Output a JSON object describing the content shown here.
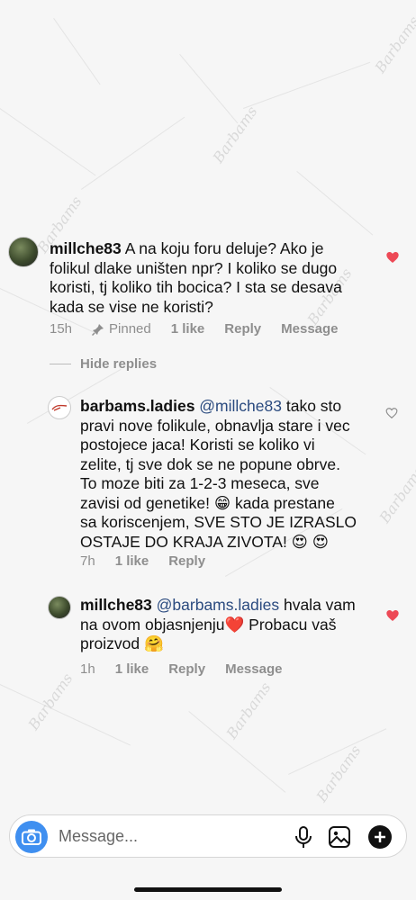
{
  "comments": [
    {
      "username": "millche83",
      "text": "A na koju foru deluje? Ako je folikul dlake uništen npr? I koliko se dugo koristi, tj koliko tih bocica? I sta se desava kada se vise ne koristi?",
      "lines": [
        "A na koju foru deluje? Ako je",
        "folikul dlake uništen npr? I koliko se dugo",
        "koristi, tj koliko tih bocica? I sta se desava",
        "kada se vise ne koristi?"
      ],
      "time": "15h",
      "pinned": "Pinned",
      "likes": "1 like",
      "reply": "Reply",
      "message": "Message",
      "liked": true
    },
    {
      "username": "barbams.ladies",
      "mention": "@millche83",
      "lines": [
        "tako sto",
        "pravi nove folikule, obnavlja stare i vec",
        "postojece jaca! Koristi se koliko vi",
        "zelite, tj sve dok se ne popune obrve.",
        "To moze biti za 1-2-3 meseca, sve",
        "zavisi od genetike! 😁  kada prestane",
        "sa koriscenjem, SVE STO JE IZRASLO",
        "OSTAJE DO KRAJA ZIVOTA! 😍 😍"
      ],
      "time": "7h",
      "likes": "1 like",
      "reply": "Reply",
      "liked": false
    },
    {
      "username": "millche83",
      "mention": "@barbams.ladies",
      "lines": [
        "hvala vam",
        "na ovom objasnjenju❤️  Probacu vaš",
        "proizvod 🤗"
      ],
      "time": "1h",
      "likes": "1 like",
      "reply": "Reply",
      "message": "Message",
      "liked": true
    }
  ],
  "hide_replies": "Hide replies",
  "composer": {
    "placeholder": "Message..."
  },
  "colors": {
    "heart_red": "#ed4956",
    "mention_blue": "#2a4a7f",
    "camera_blue": "#3f8ff0"
  }
}
